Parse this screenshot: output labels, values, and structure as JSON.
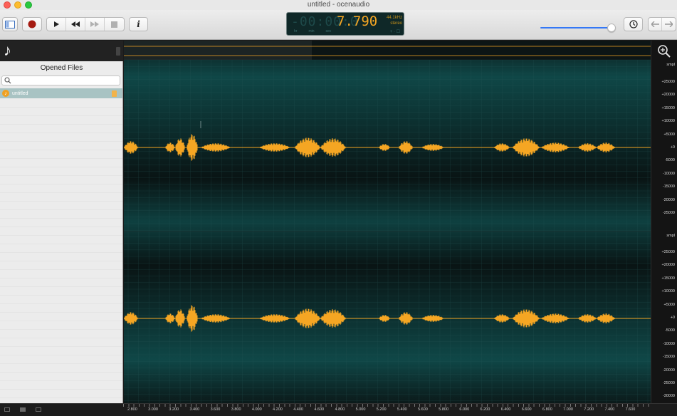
{
  "window": {
    "title": "untitled - ocenaudio"
  },
  "toolbar": {
    "lcd": {
      "ghost_digits": "-00:00:0",
      "time": "7.790",
      "sample_rate": "44.1kHz",
      "channels": "stereo",
      "units": [
        "hr",
        "min",
        "sec"
      ],
      "footer": "+ · ☐"
    },
    "volume_level": 0.96
  },
  "sidebar": {
    "title": "Opened Files",
    "search_placeholder": "",
    "files": [
      {
        "name": "untitled"
      }
    ]
  },
  "timeline": {
    "ticks": [
      "2.800",
      "3.000",
      "3.200",
      "3.400",
      "3.600",
      "3.800",
      "4.000",
      "4.200",
      "4.400",
      "4.600",
      "4.800",
      "5.000",
      "5.200",
      "5.400",
      "5.600",
      "5.800",
      "6.000",
      "6.200",
      "6.400",
      "6.600",
      "6.800",
      "7.000",
      "7.200",
      "7.400",
      "7.600"
    ]
  },
  "scale": {
    "unit": "smpl",
    "labels": [
      "+25000",
      "+20000",
      "+15000",
      "+10000",
      "+5000",
      "+0",
      "-5000",
      "-10000",
      "-15000",
      "-20000",
      "-25000"
    ],
    "lower_labels": [
      "+25000",
      "+20000",
      "+15000",
      "+10000",
      "+5000",
      "+0",
      "-5000",
      "-10000",
      "-15000",
      "-20000",
      "-25000",
      "-30000"
    ]
  },
  "colors": {
    "waveform": "#f5a623",
    "background": "#0b1818",
    "teal": "#0f4848"
  }
}
